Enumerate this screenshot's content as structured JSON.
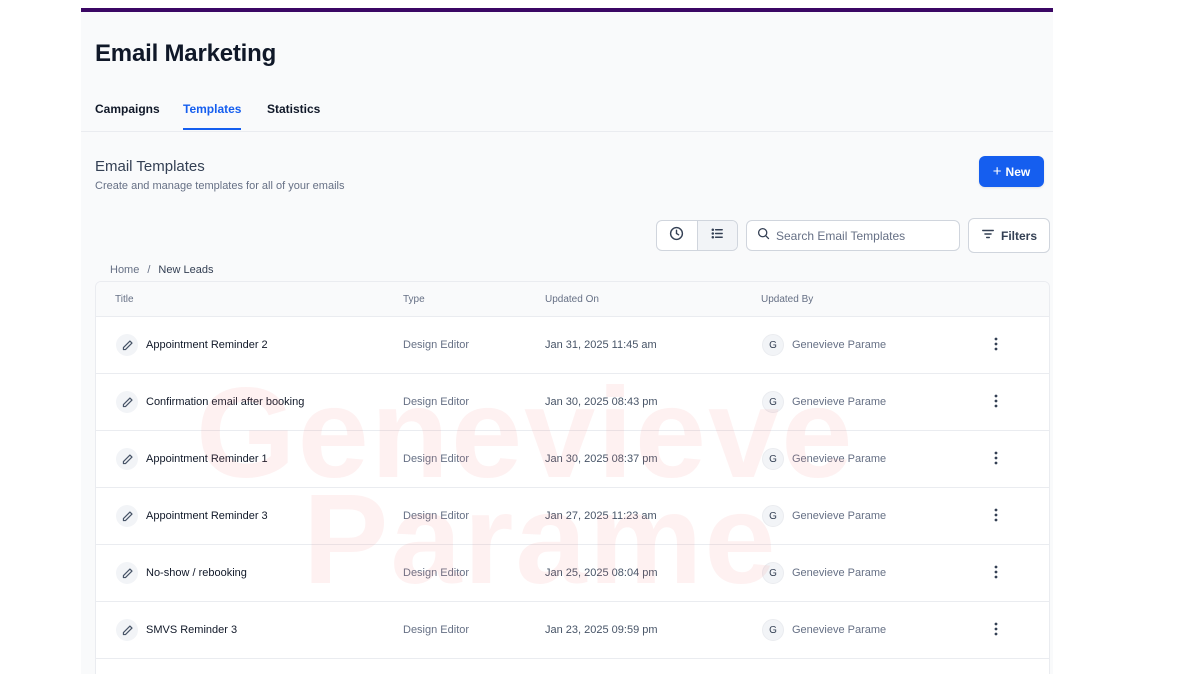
{
  "page": {
    "title": "Email Marketing"
  },
  "tabs": [
    {
      "label": "Campaigns",
      "active": false
    },
    {
      "label": "Templates",
      "active": true
    },
    {
      "label": "Statistics",
      "active": false
    }
  ],
  "section": {
    "title": "Email Templates",
    "subtitle": "Create and manage templates for all of your emails"
  },
  "toolbar": {
    "new_label": "New",
    "search_placeholder": "Search Email Templates",
    "filters_label": "Filters",
    "view_modes": [
      "clock-icon",
      "list-icon"
    ],
    "selected_view": "list"
  },
  "breadcrumb": {
    "home": "Home",
    "separator": "/",
    "current": "New Leads"
  },
  "table": {
    "columns": [
      "Title",
      "Type",
      "Updated On",
      "Updated By"
    ],
    "rows": [
      {
        "title": "Appointment Reminder 2",
        "type": "Design Editor",
        "updated_on": "Jan 31, 2025 11:45 am",
        "avatar": "G",
        "updated_by": "Genevieve Parame"
      },
      {
        "title": "Confirmation email after booking",
        "type": "Design Editor",
        "updated_on": "Jan 30, 2025 08:43 pm",
        "avatar": "G",
        "updated_by": "Genevieve Parame"
      },
      {
        "title": "Appointment Reminder 1",
        "type": "Design Editor",
        "updated_on": "Jan 30, 2025 08:37 pm",
        "avatar": "G",
        "updated_by": "Genevieve Parame"
      },
      {
        "title": "Appointment Reminder 3",
        "type": "Design Editor",
        "updated_on": "Jan 27, 2025 11:23 am",
        "avatar": "G",
        "updated_by": "Genevieve Parame"
      },
      {
        "title": "No-show / rebooking",
        "type": "Design Editor",
        "updated_on": "Jan 25, 2025 08:04 pm",
        "avatar": "G",
        "updated_by": "Genevieve Parame"
      },
      {
        "title": "SMVS Reminder 3",
        "type": "Design Editor",
        "updated_on": "Jan 23, 2025 09:59 pm",
        "avatar": "G",
        "updated_by": "Genevieve Parame"
      }
    ]
  },
  "watermark": {
    "line1": "Genevieve",
    "line2": "Parame"
  },
  "colors": {
    "accent": "#155eef",
    "top_bar": "#3b0764",
    "watermark": "#f87171"
  }
}
